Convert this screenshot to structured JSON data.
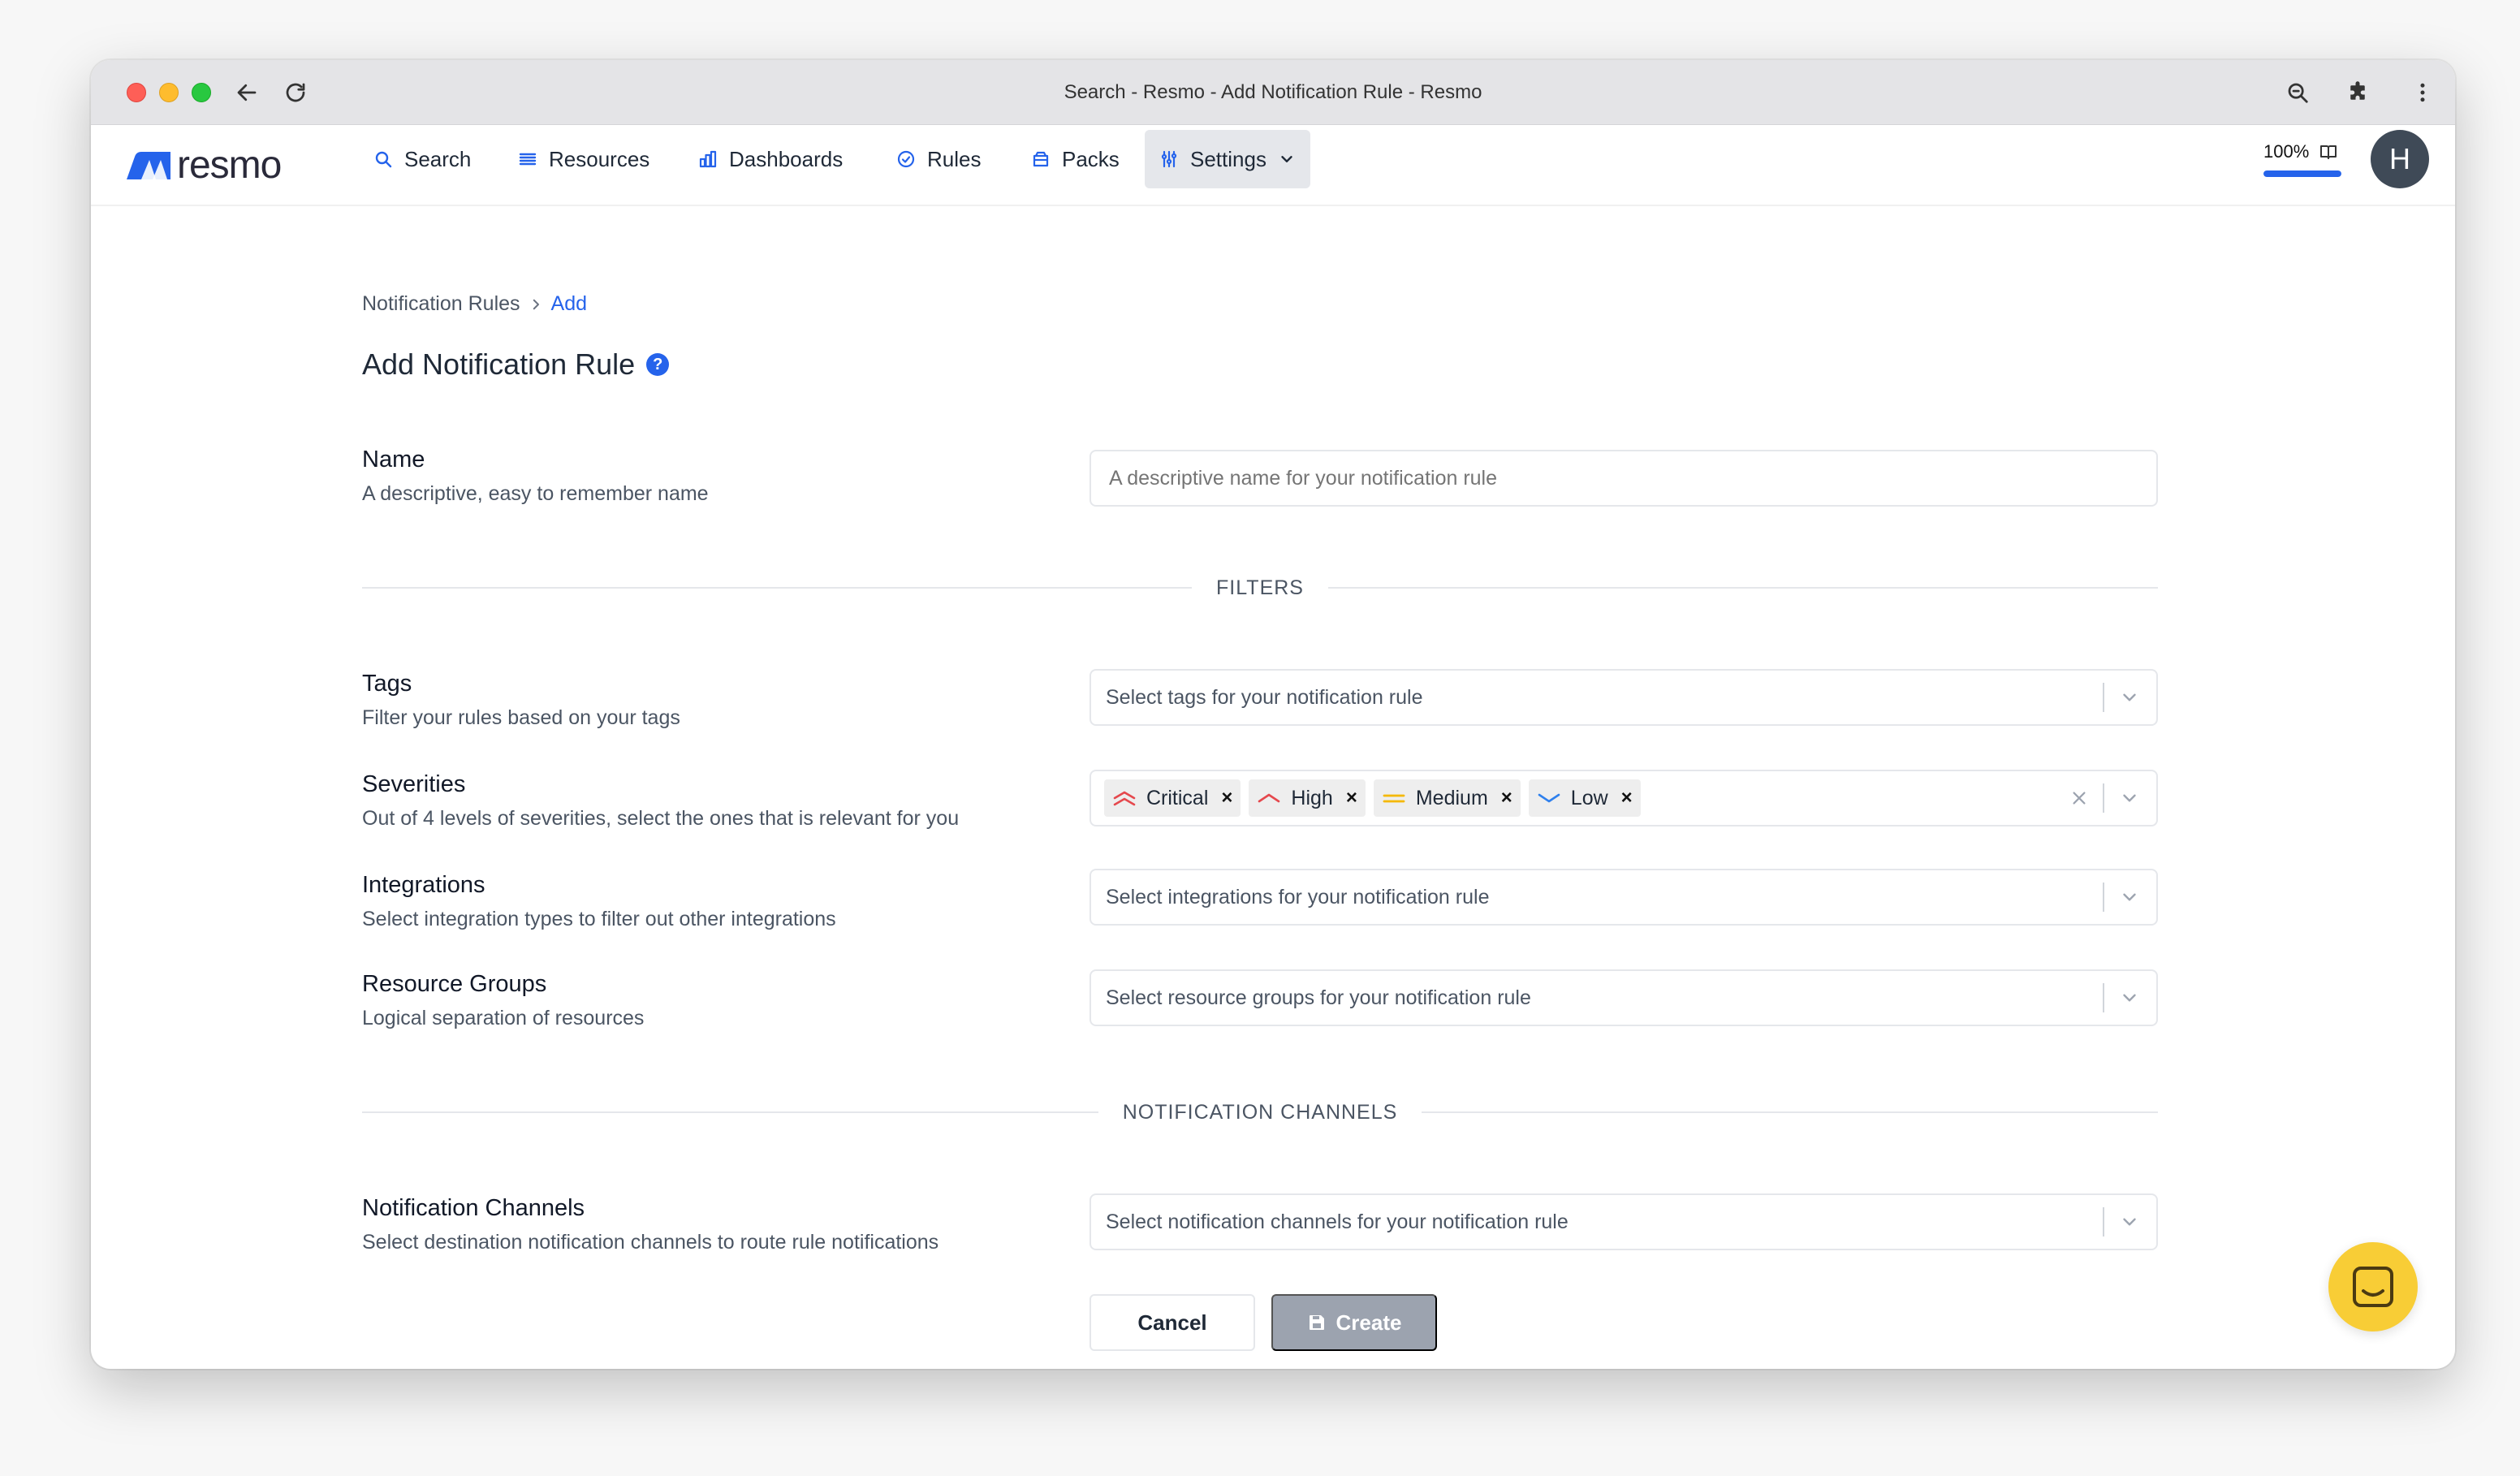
{
  "window": {
    "title": "Search - Resmo - Add Notification Rule - Resmo"
  },
  "app": {
    "logo_text": "resmo",
    "brand_color": "#2563eb"
  },
  "nav": {
    "items": [
      {
        "label": "Search",
        "icon": "search-icon"
      },
      {
        "label": "Resources",
        "icon": "list-icon"
      },
      {
        "label": "Dashboards",
        "icon": "bar-chart-icon"
      },
      {
        "label": "Rules",
        "icon": "check-circle-icon"
      },
      {
        "label": "Packs",
        "icon": "package-icon"
      },
      {
        "label": "Settings",
        "icon": "sliders-icon",
        "active": true
      }
    ],
    "zoom_label": "100%",
    "zoom_progress": 1.0,
    "avatar_initial": "H"
  },
  "breadcrumb": {
    "root": "Notification Rules",
    "current": "Add"
  },
  "page": {
    "title": "Add Notification Rule",
    "help_icon": "?"
  },
  "form": {
    "name": {
      "label": "Name",
      "help": "A descriptive, easy to remember name",
      "placeholder": "A descriptive name for your notification rule",
      "value": ""
    },
    "filters_divider": "FILTERS",
    "tags": {
      "label": "Tags",
      "help": "Filter your rules based on your tags",
      "placeholder": "Select tags for your notification rule"
    },
    "severities": {
      "label": "Severities",
      "help": "Out of 4 levels of severities, select the ones that is relevant for you",
      "selected": [
        {
          "label": "Critical",
          "icon": "double-chevron-up-icon",
          "color": "#e5484d"
        },
        {
          "label": "High",
          "icon": "chevron-up-icon",
          "color": "#e5484d"
        },
        {
          "label": "Medium",
          "icon": "equals-icon",
          "color": "#f5b800"
        },
        {
          "label": "Low",
          "icon": "chevron-down-icon",
          "color": "#2f80ed"
        }
      ],
      "remove_symbol": "×"
    },
    "integrations": {
      "label": "Integrations",
      "help": "Select integration types to filter out other integrations",
      "placeholder": "Select integrations for your notification rule"
    },
    "resource_groups": {
      "label": "Resource Groups",
      "help": "Logical separation of resources",
      "placeholder": "Select resource groups for your notification rule"
    },
    "channels_divider": "NOTIFICATION CHANNELS",
    "notification_channels": {
      "label": "Notification Channels",
      "help": "Select destination notification channels to route rule notifications",
      "placeholder": "Select notification channels for your notification rule"
    },
    "cancel_label": "Cancel",
    "create_label": "Create"
  }
}
